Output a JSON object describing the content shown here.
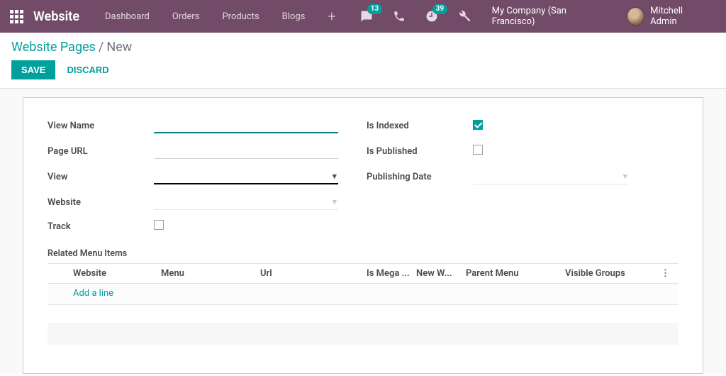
{
  "navbar": {
    "brand": "Website",
    "menu": [
      "Dashboard",
      "Orders",
      "Products",
      "Blogs"
    ],
    "messages": "13",
    "activities": "39",
    "company": "My Company (San Francisco)",
    "user": "Mitchell Admin"
  },
  "breadcrumb": {
    "root": "Website Pages",
    "sep": "/",
    "current": "New"
  },
  "buttons": {
    "save": "Save",
    "discard": "Discard"
  },
  "labels": {
    "view_name": "View Name",
    "page_url": "Page URL",
    "view": "View",
    "website": "Website",
    "track": "Track",
    "is_indexed": "Is Indexed",
    "is_published": "Is Published",
    "publishing_date": "Publishing Date",
    "related_menu": "Related Menu Items"
  },
  "values": {
    "view_name": "",
    "page_url": "",
    "view": "",
    "website": "",
    "track": false,
    "is_indexed": true,
    "is_published": false,
    "publishing_date": ""
  },
  "list": {
    "columns": {
      "website": "Website",
      "menu": "Menu",
      "url": "Url",
      "is_mega": "Is Mega ...",
      "new_w": "New W...",
      "parent": "Parent Menu",
      "groups": "Visible Groups"
    },
    "add_line": "Add a line"
  }
}
